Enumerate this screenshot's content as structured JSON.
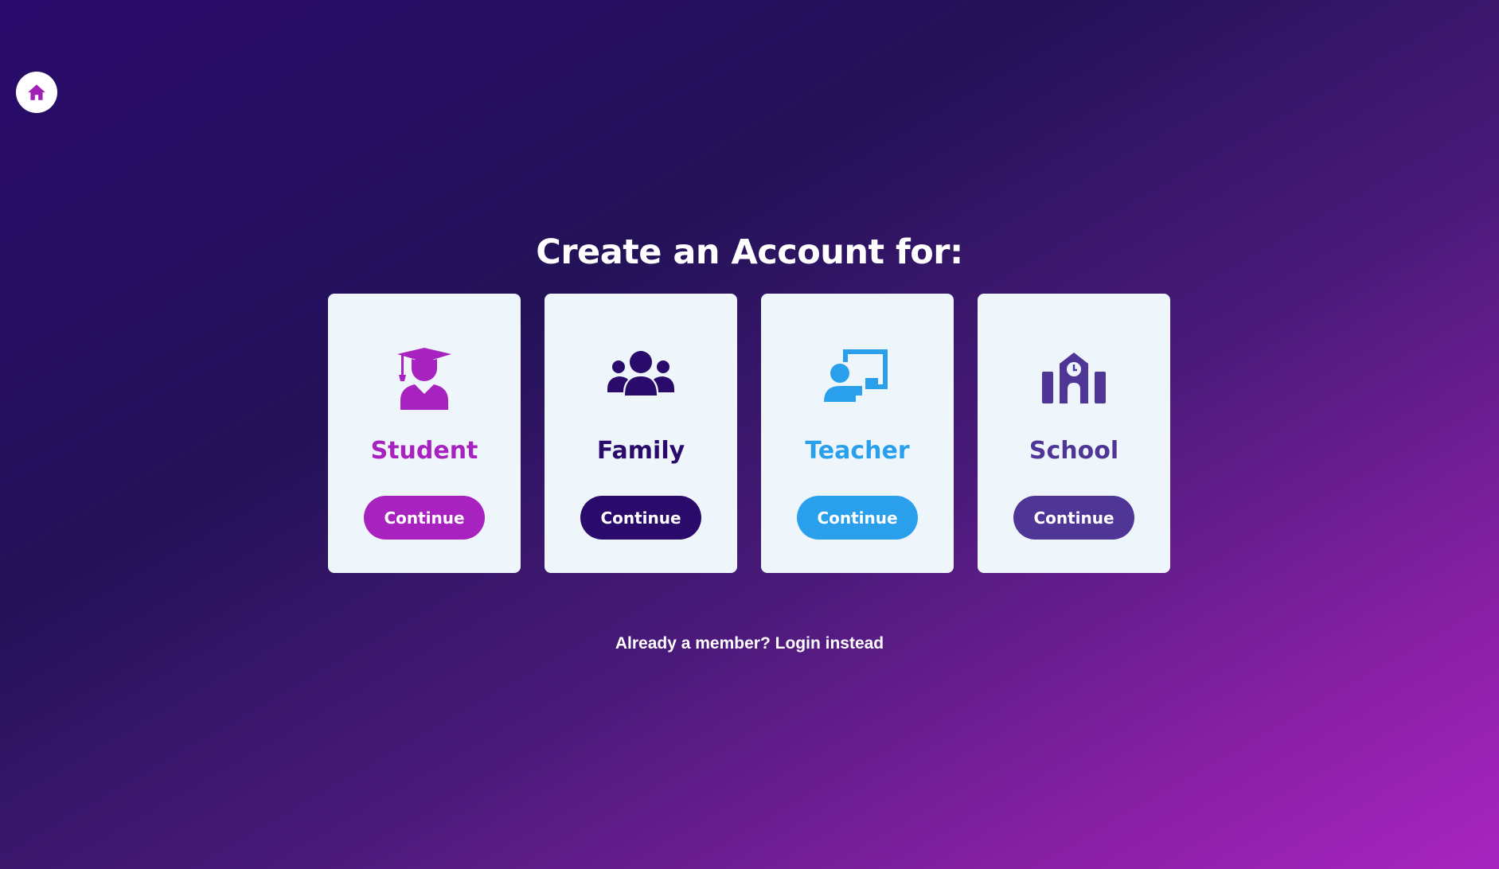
{
  "home": {
    "icon": "home-icon",
    "color": "#a020b8"
  },
  "title": "Create an Account for:",
  "cards": [
    {
      "label": "Student",
      "icon": "graduate-icon",
      "button": "Continue",
      "color": "#a822c0"
    },
    {
      "label": "Family",
      "icon": "family-icon",
      "button": "Continue",
      "color": "#2a0a6b"
    },
    {
      "label": "Teacher",
      "icon": "teacher-icon",
      "button": "Continue",
      "color": "#2aa0ec"
    },
    {
      "label": "School",
      "icon": "school-icon",
      "button": "Continue",
      "color": "#4f3696"
    }
  ],
  "footer": {
    "prompt": "Already a member?",
    "link": "Login instead"
  }
}
